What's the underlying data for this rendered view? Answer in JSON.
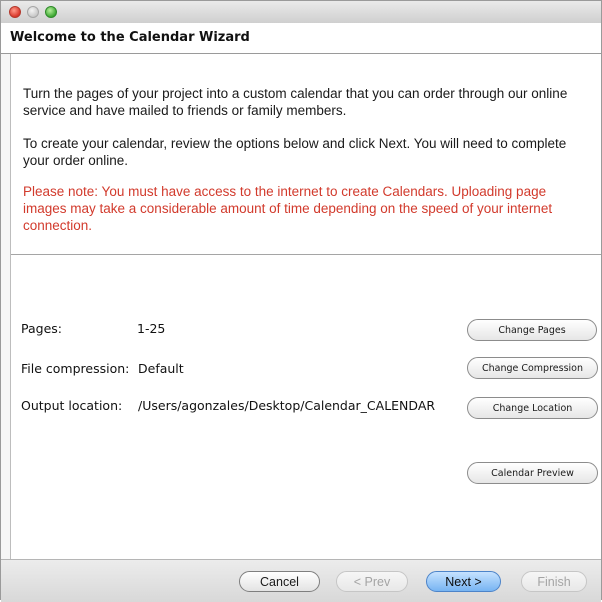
{
  "window": {
    "heading": "Welcome to the Calendar Wizard"
  },
  "intro": {
    "paragraph1": "Turn the pages of your project into a custom calendar that you can order through our online service and have mailed to friends or family members.",
    "paragraph2": "To create your calendar, review the options below and click Next. You will need to complete your order online.",
    "note": "Please note: You must have access to the internet to create Calendars. Uploading page images may take a considerable amount of time depending on the speed of your internet connection."
  },
  "settings": {
    "pages": {
      "label": "Pages:",
      "value": "1-25",
      "button": "Change Pages"
    },
    "compression": {
      "label": "File compression:",
      "value": "Default",
      "button": "Change Compression"
    },
    "location": {
      "label": "Output location:",
      "value": "/Users/agonzales/Desktop/Calendar_CALENDAR",
      "button": "Change Location"
    },
    "preview_button": "Calendar Preview"
  },
  "footer": {
    "cancel": "Cancel",
    "prev": "< Prev",
    "next": "Next >",
    "finish": "Finish"
  },
  "colors": {
    "note_text": "#d23a2c",
    "next_button": "#77b4f2",
    "close_light": "#d9372a",
    "zoom_light": "#3ea833"
  }
}
